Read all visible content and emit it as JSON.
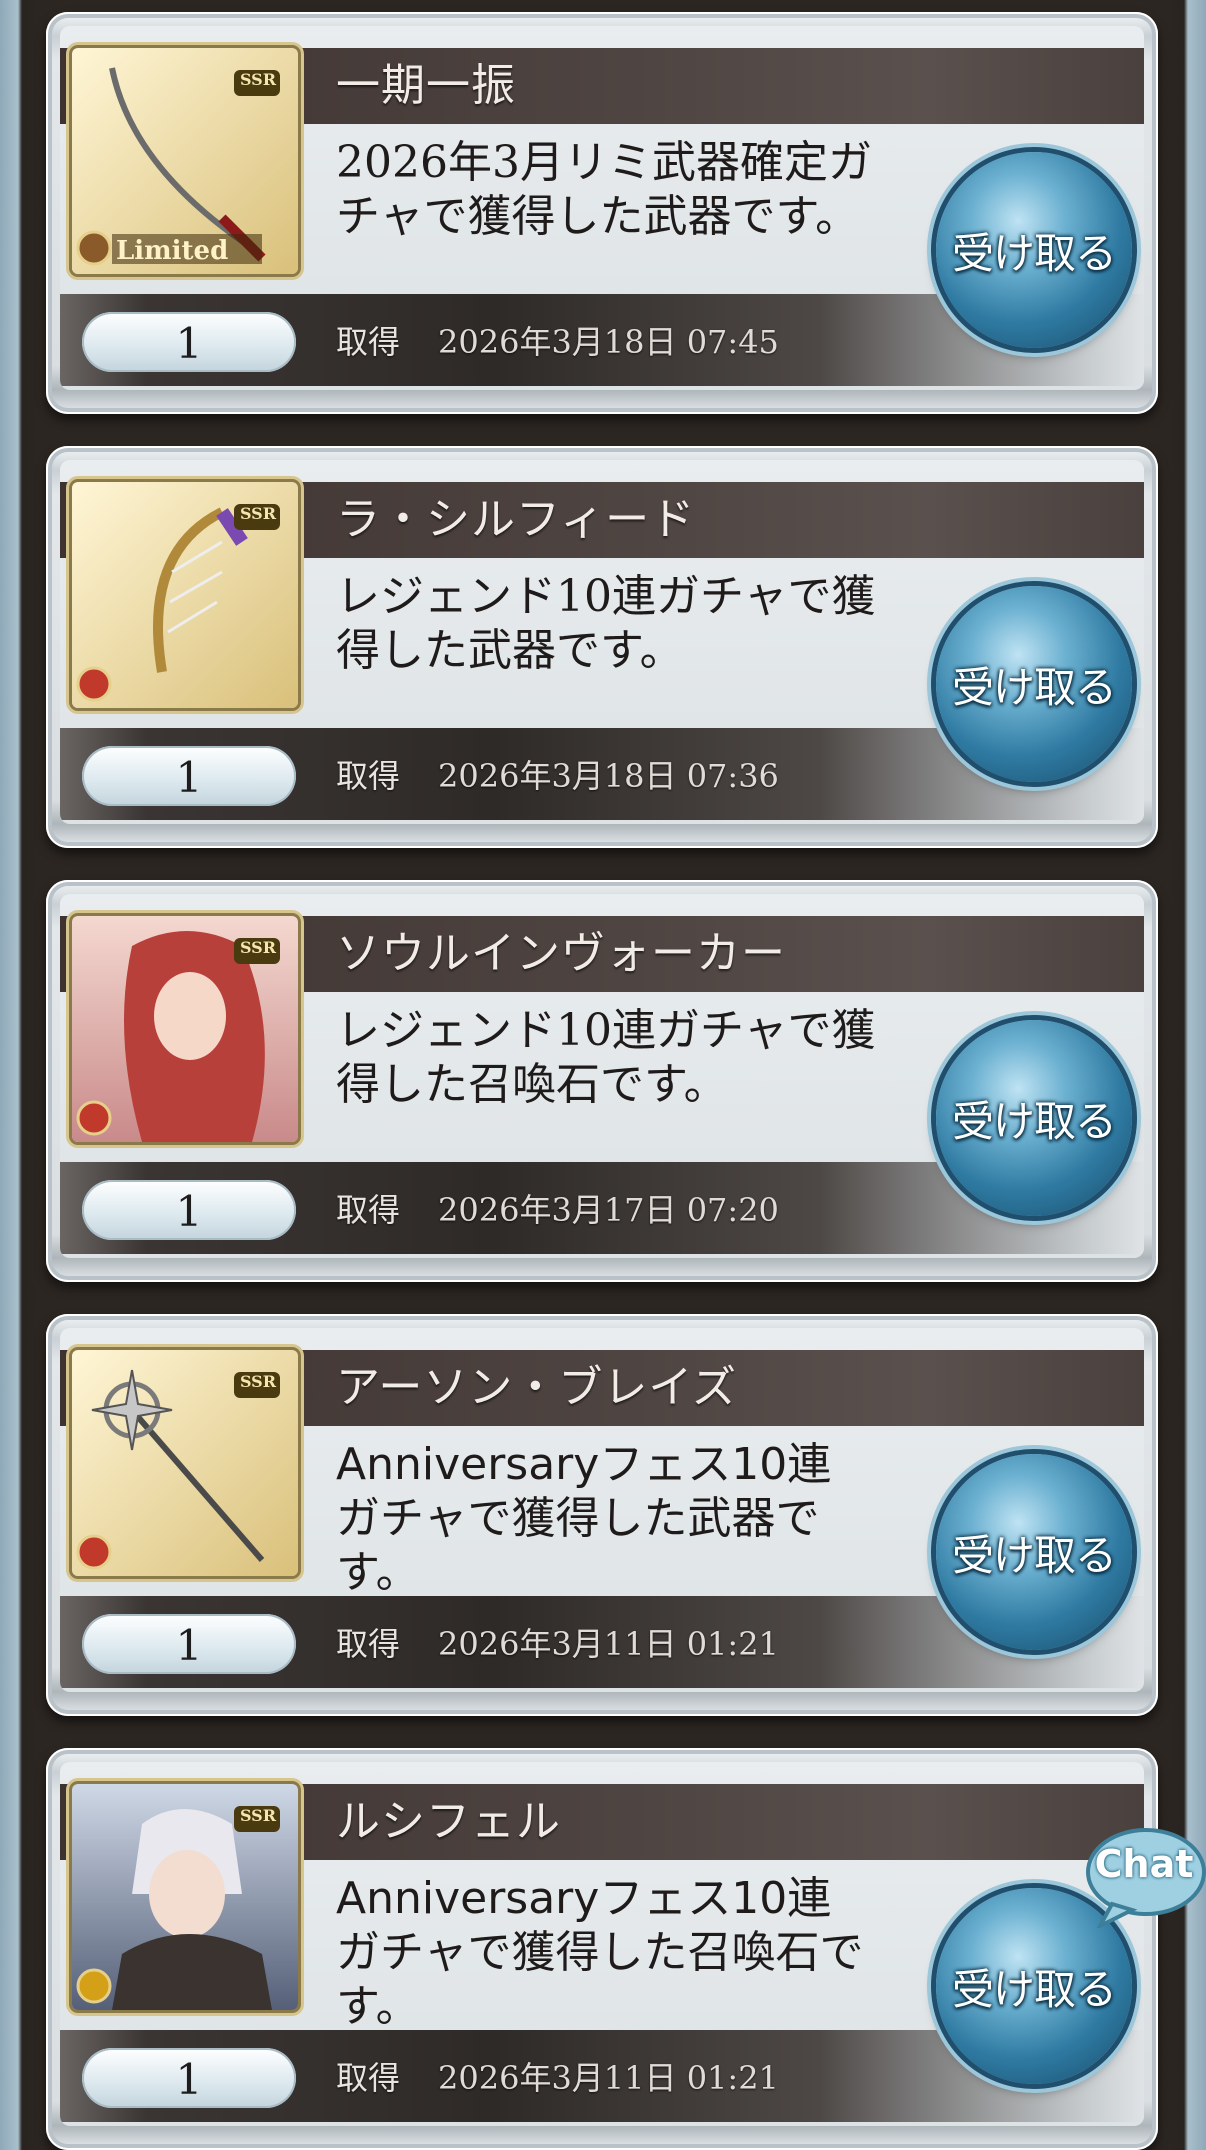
{
  "items": [
    {
      "name": "一期一振",
      "desc_lines": [
        "2026年3月リミ武器確定ガ",
        "チャで獲得した武器です。"
      ],
      "qty": "1",
      "acquired_label": "取得",
      "acquired_date": "2026年3月18日 07:45",
      "claim_label": "受け取る",
      "rarity": "SSR",
      "badge": "Limited",
      "icon": "katana-icon",
      "element_color": "#c0392b"
    },
    {
      "name": "ラ・シルフィード",
      "desc_lines": [
        "レジェンド10連ガチャで獲",
        "得した武器です。"
      ],
      "qty": "1",
      "acquired_label": "取得",
      "acquired_date": "2026年3月18日 07:36",
      "claim_label": "受け取る",
      "rarity": "SSR",
      "icon": "harp-icon",
      "element_color": "#c0392b"
    },
    {
      "name": "ソウルインヴォーカー",
      "desc_lines": [
        "レジェンド10連ガチャで獲",
        "得した召喚石です。"
      ],
      "qty": "1",
      "acquired_label": "取得",
      "acquired_date": "2026年3月17日 07:20",
      "claim_label": "受け取る",
      "rarity": "SSR",
      "icon": "summon-portrait-icon",
      "element_color": "#c0392b"
    },
    {
      "name": "アーソン・ブレイズ",
      "desc_lines": [
        "Anniversaryフェス10連",
        "ガチャで獲得した武器で",
        "す。"
      ],
      "qty": "1",
      "acquired_label": "取得",
      "acquired_date": "2026年3月11日 01:21",
      "claim_label": "受け取る",
      "rarity": "SSR",
      "icon": "staff-icon",
      "element_color": "#c0392b"
    },
    {
      "name": "ルシフェル",
      "desc_lines": [
        "Anniversaryフェス10連",
        "ガチャで獲得した召喚石で",
        "す。"
      ],
      "qty": "1",
      "acquired_label": "取得",
      "acquired_date": "2026年3月11日 01:21",
      "claim_label": "受け取る",
      "rarity": "SSR",
      "icon": "summon-portrait-icon",
      "element_color": "#d4a017"
    }
  ],
  "chat": {
    "label": "Chat"
  }
}
